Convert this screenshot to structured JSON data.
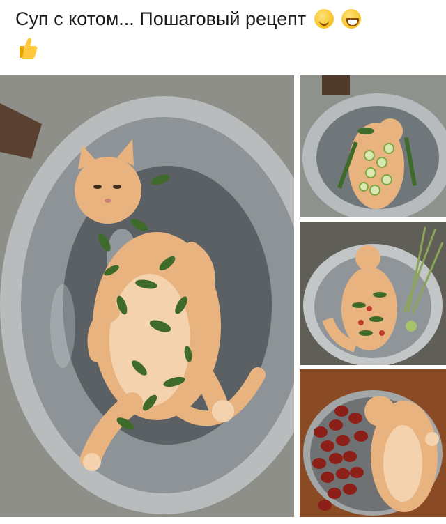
{
  "post": {
    "caption": "Суп с котом... Пошаговый рецепт",
    "emojis": [
      "smiling-face-emoji",
      "grinning-face-emoji",
      "thumbs-up-emoji"
    ]
  },
  "colors": {
    "cat": "#e9b27a",
    "wok": "#6f7478",
    "herbs": "#3f6b2a",
    "table": "#8a4a24",
    "sausage": "#8c1f17"
  }
}
